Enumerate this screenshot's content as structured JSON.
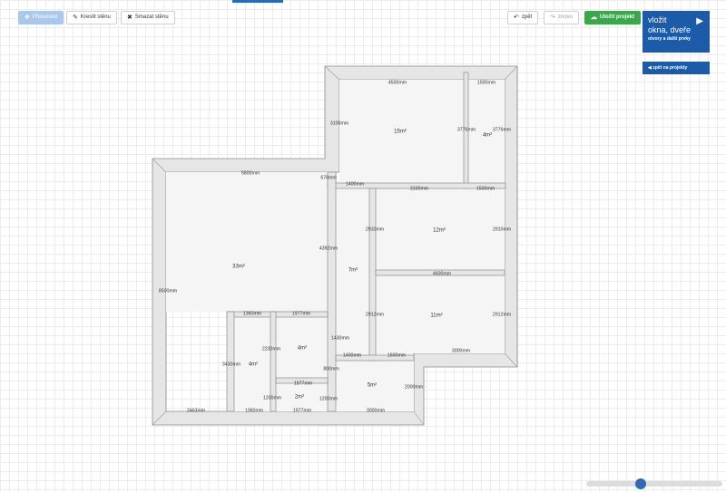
{
  "toolbar": {
    "select_label": "Přesunout",
    "draw_label": "Kreslit stěnu",
    "delete_label": "Smazat stěnu",
    "undo_label": "zpět",
    "redo_label": "znovu",
    "save_label": "Uložit projekt",
    "icons": {
      "select": "move-icon",
      "draw": "pencil-icon",
      "delete": "close-icon",
      "undo": "undo-icon",
      "redo": "redo-icon",
      "save": "cloud-upload-icon"
    }
  },
  "insert_panel": {
    "line1": "vložit",
    "line2": "okna, dveře",
    "line3": "otvory a další prvky",
    "icon": "chevron-right-icon"
  },
  "back_button": {
    "label": "zpět na projekty",
    "icon": "chevron-left-icon"
  },
  "colors": {
    "primary": "#1c5ba8",
    "save_green": "#3ca64b",
    "wall_fill": "#e6e6e6",
    "room_fill": "#f5f5f5"
  },
  "floor_plan": {
    "areas": [
      "15m²",
      "4m²",
      "33m²",
      "12m²",
      "7m²",
      "11m²",
      "4m²",
      "4m²",
      "2m²",
      "5m²"
    ],
    "dimensions": [
      "4500mm",
      "1500mm",
      "3100mm",
      "3776mm",
      "3776mm",
      "5800mm",
      "678mm",
      "1400mm",
      "3100mm",
      "1500mm",
      "2910mm",
      "2910mm",
      "4392mm",
      "4600mm",
      "8500mm",
      "2912mm",
      "2912mm",
      "1360mm",
      "1977mm",
      "1430mm",
      "2230mm",
      "3430mm",
      "1400mm",
      "1600mm",
      "3000mm",
      "800mm",
      "1977mm",
      "1200mm",
      "1200mm",
      "2000mm",
      "2463mm",
      "1360mm",
      "1977mm",
      "3000mm"
    ]
  },
  "zoom": {
    "level": 0.4
  }
}
